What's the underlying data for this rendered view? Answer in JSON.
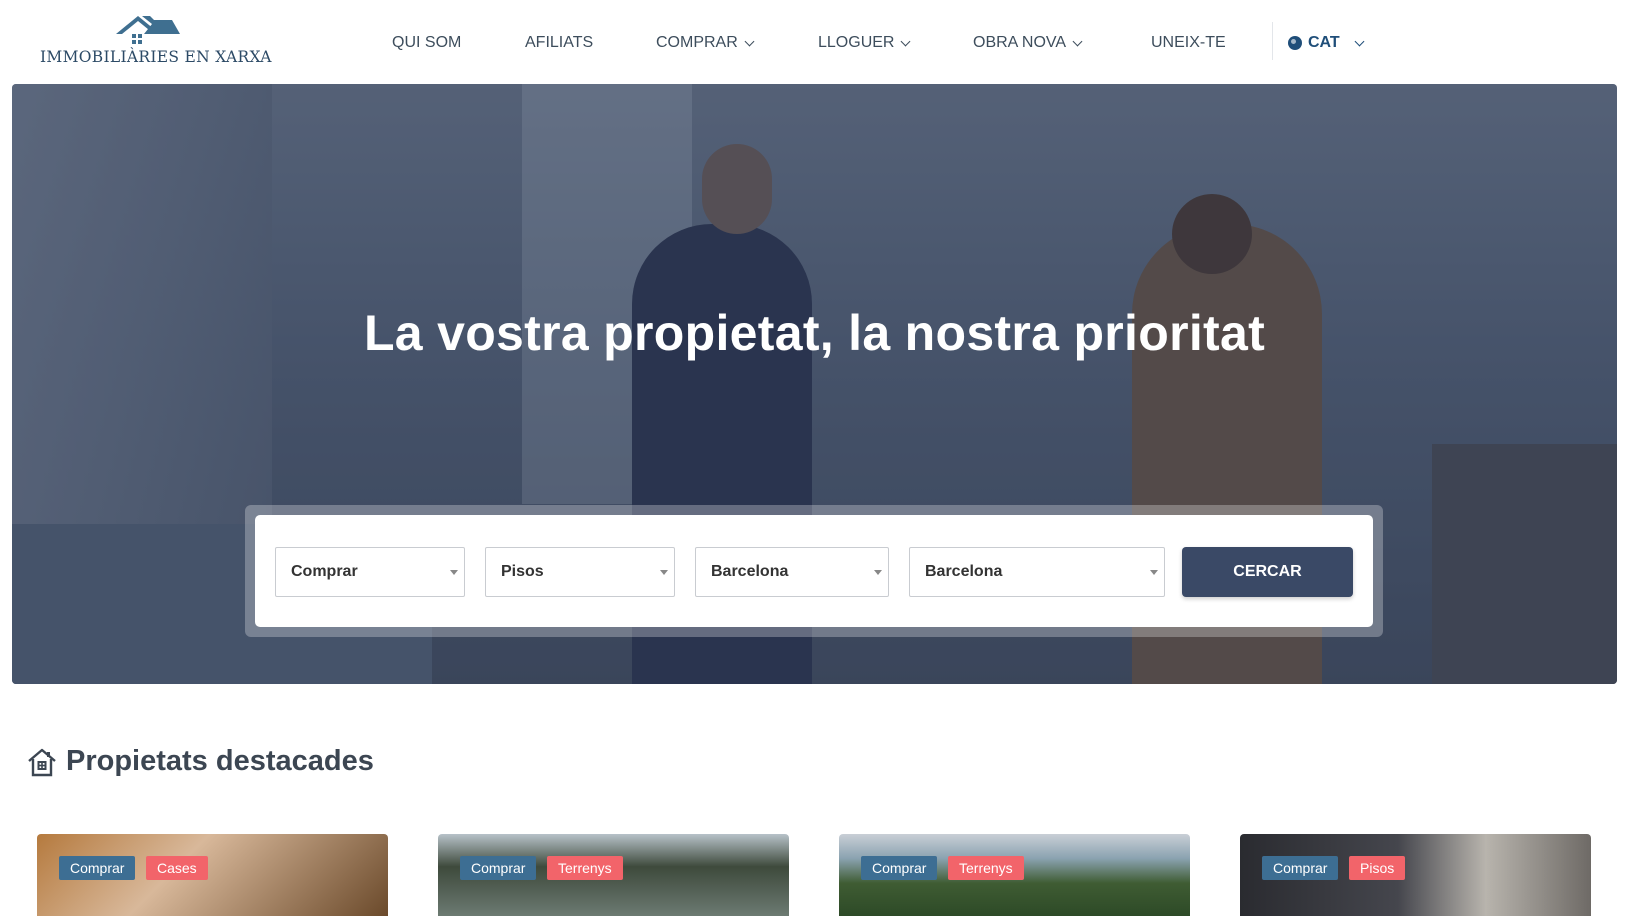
{
  "header": {
    "logo_text": "IMMOBILIÀRIES EN XARXA",
    "nav": [
      {
        "label": "QUI SOM",
        "has_dropdown": false
      },
      {
        "label": "AFILIATS",
        "has_dropdown": false
      },
      {
        "label": "COMPRAR",
        "has_dropdown": true
      },
      {
        "label": "LLOGUER",
        "has_dropdown": true
      },
      {
        "label": "OBRA NOVA",
        "has_dropdown": true
      },
      {
        "label": "UNEIX-TE",
        "has_dropdown": false
      }
    ],
    "language": "CAT"
  },
  "hero": {
    "title": "La vostra propietat, la nostra prioritat"
  },
  "search": {
    "operation": "Comprar",
    "type": "Pisos",
    "province": "Barcelona",
    "city": "Barcelona",
    "button_label": "CERCAR"
  },
  "featured": {
    "title": "Propietats destacades",
    "cards": [
      {
        "operation": "Comprar",
        "category": "Cases"
      },
      {
        "operation": "Comprar",
        "category": "Terrenys"
      },
      {
        "operation": "Comprar",
        "category": "Terrenys"
      },
      {
        "operation": "Comprar",
        "category": "Pisos"
      }
    ]
  },
  "colors": {
    "brand_dark": "#3a4966",
    "badge_blue": "#3d6e93",
    "badge_red": "#f2646a",
    "logo": "#2c4a66"
  }
}
